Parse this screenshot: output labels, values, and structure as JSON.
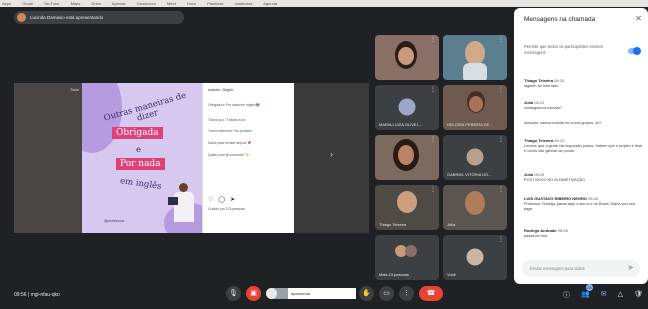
{
  "bookmarks": [
    "Apps",
    "Gmail",
    "YouTube",
    "Maps",
    "Drive",
    "Agenda",
    "Classroom",
    "Meet",
    "Docs",
    "Planilhas",
    "Jamboard",
    "Agenda"
  ],
  "presenter": {
    "label": "Lucinda Damasio está apresentando"
  },
  "stage": {
    "left_label": "Toda",
    "slide": {
      "title": "Outras maneiras de dizer",
      "word1": "Obrigada",
      "conjunction": "e",
      "word2": "Por nada",
      "suffix": "em inglês",
      "credit": "@professora"
    },
    "post": {
      "account": "lucinda • Seguir",
      "lines": [
        "Obrigada e Por nada em inglês 🇺🇸",
        "Thank you / Thanks a lot",
        "You're welcome / No problem",
        "Salve para revisar depois 📌",
        "Quais você já conhecia? 👇"
      ],
      "likes": "Curtido por 123 pessoas"
    }
  },
  "tiles": [
    {
      "name": "",
      "bg": "#8a6f66"
    },
    {
      "name": "",
      "bg": "#5b7f8e"
    },
    {
      "name": "MARIA LUIZA OLIVEI...",
      "bg": "#3c4043"
    },
    {
      "name": "HELOÍSA PEREIRA DE...",
      "bg": "#6e5a50"
    },
    {
      "name": "",
      "bg": "#7d6a5e"
    },
    {
      "name": "GABRIEL VITÓRIA DO...",
      "bg": "#3c4043"
    },
    {
      "name": "Thiago Teixeira",
      "bg": "#4e4a44"
    },
    {
      "name": "Júlia",
      "bg": "#5a5550"
    },
    {
      "name": "Mais 23 pessoas",
      "bg": "#3c4043"
    },
    {
      "name": "Você",
      "bg": "#3c4043"
    }
  ],
  "chat": {
    "title": "Mensagens na chamada",
    "setting": "Permitir que todos os participantes enviem mensagens",
    "messages": [
      {
        "who": "Thiago Teixeira",
        "time": "08:20",
        "text": "alguém ao meu lado"
      },
      {
        "who": "Júlia",
        "time": "08:22",
        "text": "conseguimos escutar?"
      },
      {
        "who": "",
        "time": "",
        "text": "Atenção: vamos montar os novos grupos, ok?"
      },
      {
        "who": "Thiago Teixeira",
        "time": "08:24",
        "text": "Lembre que a gente vai responder juntos. Sabem que o projeto é final e vocês vão ganhar um ponto"
      },
      {
        "who": "Júlia",
        "time": "08:25",
        "text": "POST NOVO NO ALFABETIZAÇÃO"
      },
      {
        "who": "LUIS GUSTAVO RIBEIRO NEGRO",
        "time": "08:26",
        "text": "Professor: Rodrigo passa aqui o seu id é do Brasil. Diana you rica page"
      },
      {
        "who": "Rodrigo Andrade",
        "time": "08:28",
        "text": "passa em link."
      }
    ],
    "input_placeholder": "Enviar mensagem para todos"
  },
  "meeting": {
    "time": "09:56",
    "code": "mgi-nfau-qko"
  },
  "controls": {
    "present_label": "apresentar"
  },
  "participants_count": "25"
}
